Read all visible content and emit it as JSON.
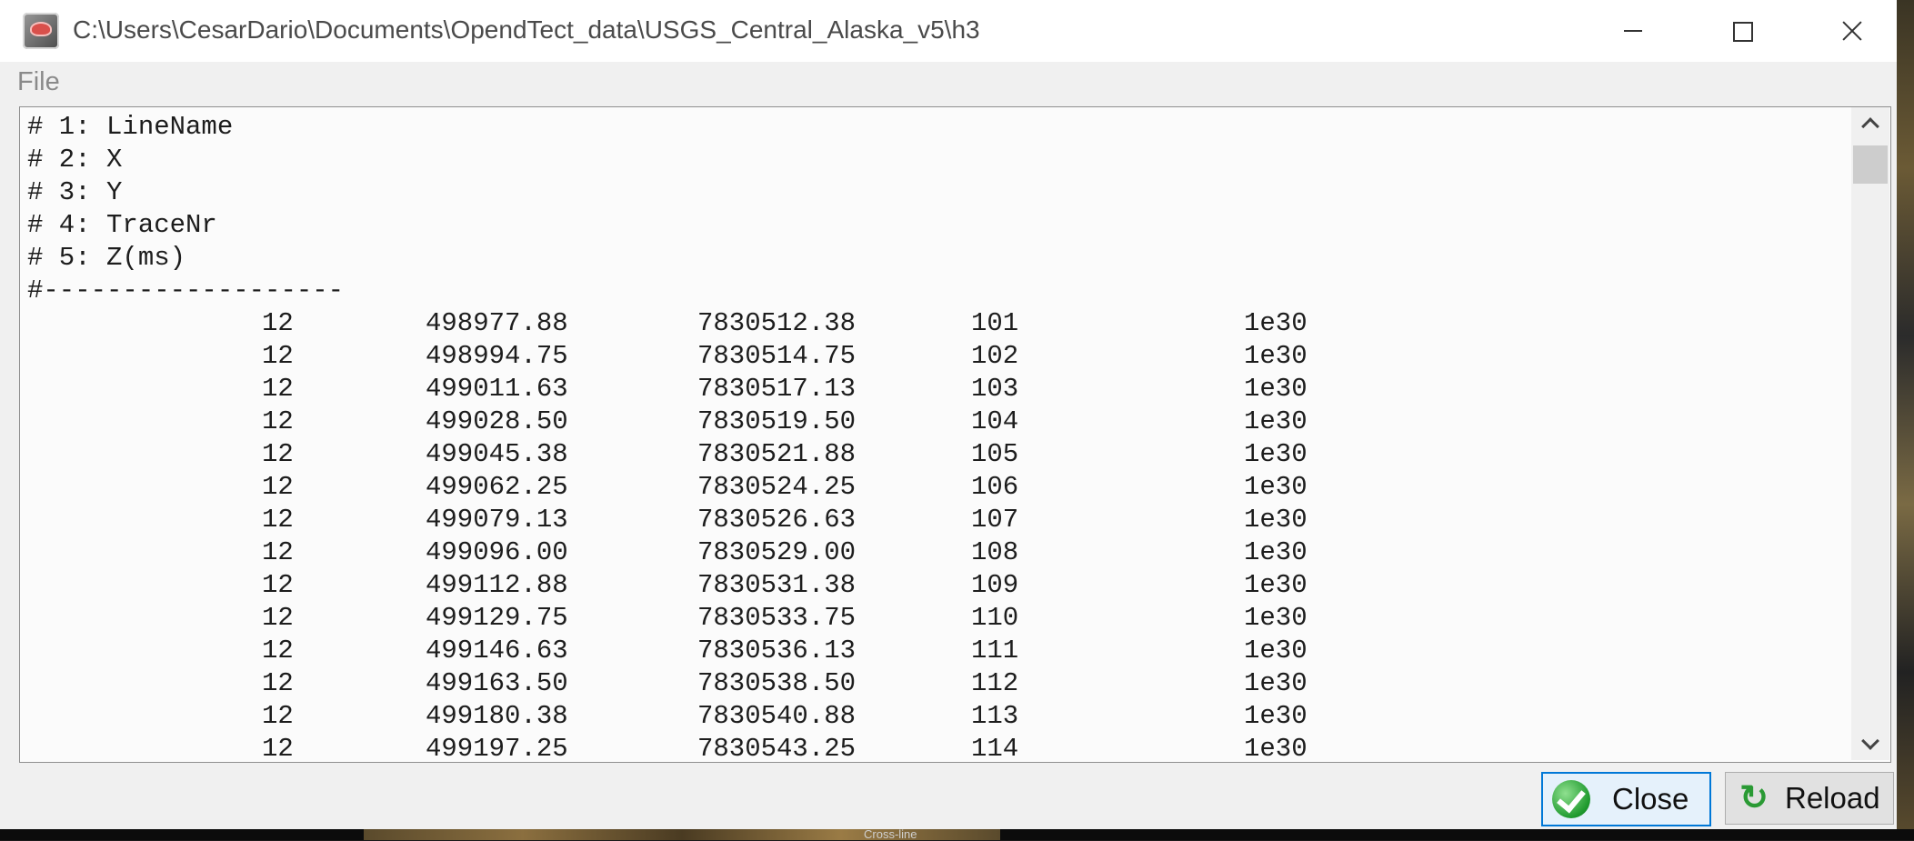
{
  "window": {
    "title": "C:\\Users\\CesarDario\\Documents\\OpendTect_data\\USGS_Central_Alaska_v5\\h3"
  },
  "menu": {
    "file": "File"
  },
  "content": {
    "header_lines": [
      "# 1: LineName",
      "# 2: X",
      "# 3: Y",
      "# 4: TraceNr",
      "# 5: Z(ms)",
      "#-------------------"
    ],
    "rows": [
      [
        "12",
        "498977.88",
        "7830512.38",
        "101",
        "1e30"
      ],
      [
        "12",
        "498994.75",
        "7830514.75",
        "102",
        "1e30"
      ],
      [
        "12",
        "499011.63",
        "7830517.13",
        "103",
        "1e30"
      ],
      [
        "12",
        "499028.50",
        "7830519.50",
        "104",
        "1e30"
      ],
      [
        "12",
        "499045.38",
        "7830521.88",
        "105",
        "1e30"
      ],
      [
        "12",
        "499062.25",
        "7830524.25",
        "106",
        "1e30"
      ],
      [
        "12",
        "499079.13",
        "7830526.63",
        "107",
        "1e30"
      ],
      [
        "12",
        "499096.00",
        "7830529.00",
        "108",
        "1e30"
      ],
      [
        "12",
        "499112.88",
        "7830531.38",
        "109",
        "1e30"
      ],
      [
        "12",
        "499129.75",
        "7830533.75",
        "110",
        "1e30"
      ],
      [
        "12",
        "499146.63",
        "7830536.13",
        "111",
        "1e30"
      ],
      [
        "12",
        "499163.50",
        "7830538.50",
        "112",
        "1e30"
      ],
      [
        "12",
        "499180.38",
        "7830540.88",
        "113",
        "1e30"
      ],
      [
        "12",
        "499197.25",
        "7830543.25",
        "114",
        "1e30"
      ]
    ]
  },
  "buttons": {
    "close": "Close",
    "reload": "Reload"
  },
  "icons": {
    "app": "opendtect-app-icon",
    "close": "green-checkmark-icon",
    "reload": "green-refresh-icon"
  },
  "background": {
    "label": "Cross-line"
  }
}
